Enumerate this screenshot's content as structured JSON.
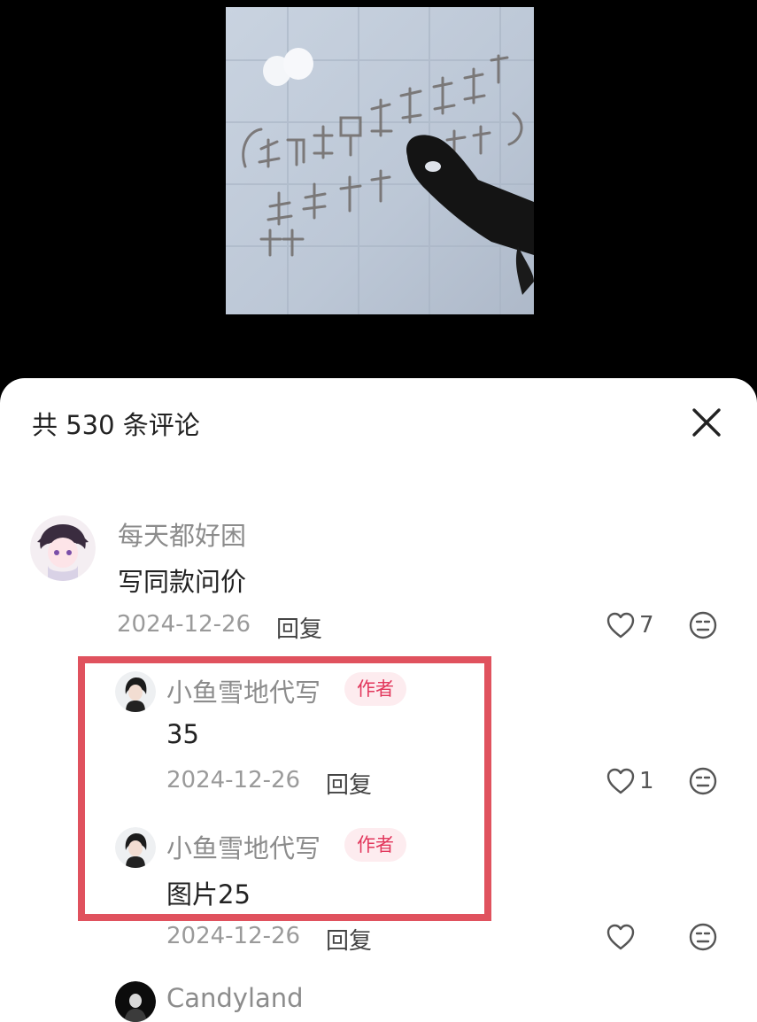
{
  "header": {
    "title": "共 530 条评论",
    "close_icon": "close-icon"
  },
  "comments": [
    {
      "user": "每天都好困",
      "text": "写同款问价",
      "date": "2024-12-26",
      "reply_label": "回复",
      "likes": "7",
      "replies": [
        {
          "user": "小鱼雪地代写",
          "badge": "作者",
          "text": "35",
          "date": "2024-12-26",
          "reply_label": "回复",
          "likes": "1"
        },
        {
          "user": "小鱼雪地代写",
          "badge": "作者",
          "text": "图片25",
          "date": "2024-12-26",
          "reply_label": "回复",
          "likes": ""
        }
      ]
    },
    {
      "user": "Candyland"
    }
  ],
  "colors": {
    "accent": "#e2375c",
    "highlight_border": "#e0525e",
    "badge_bg": "#fdecef"
  }
}
